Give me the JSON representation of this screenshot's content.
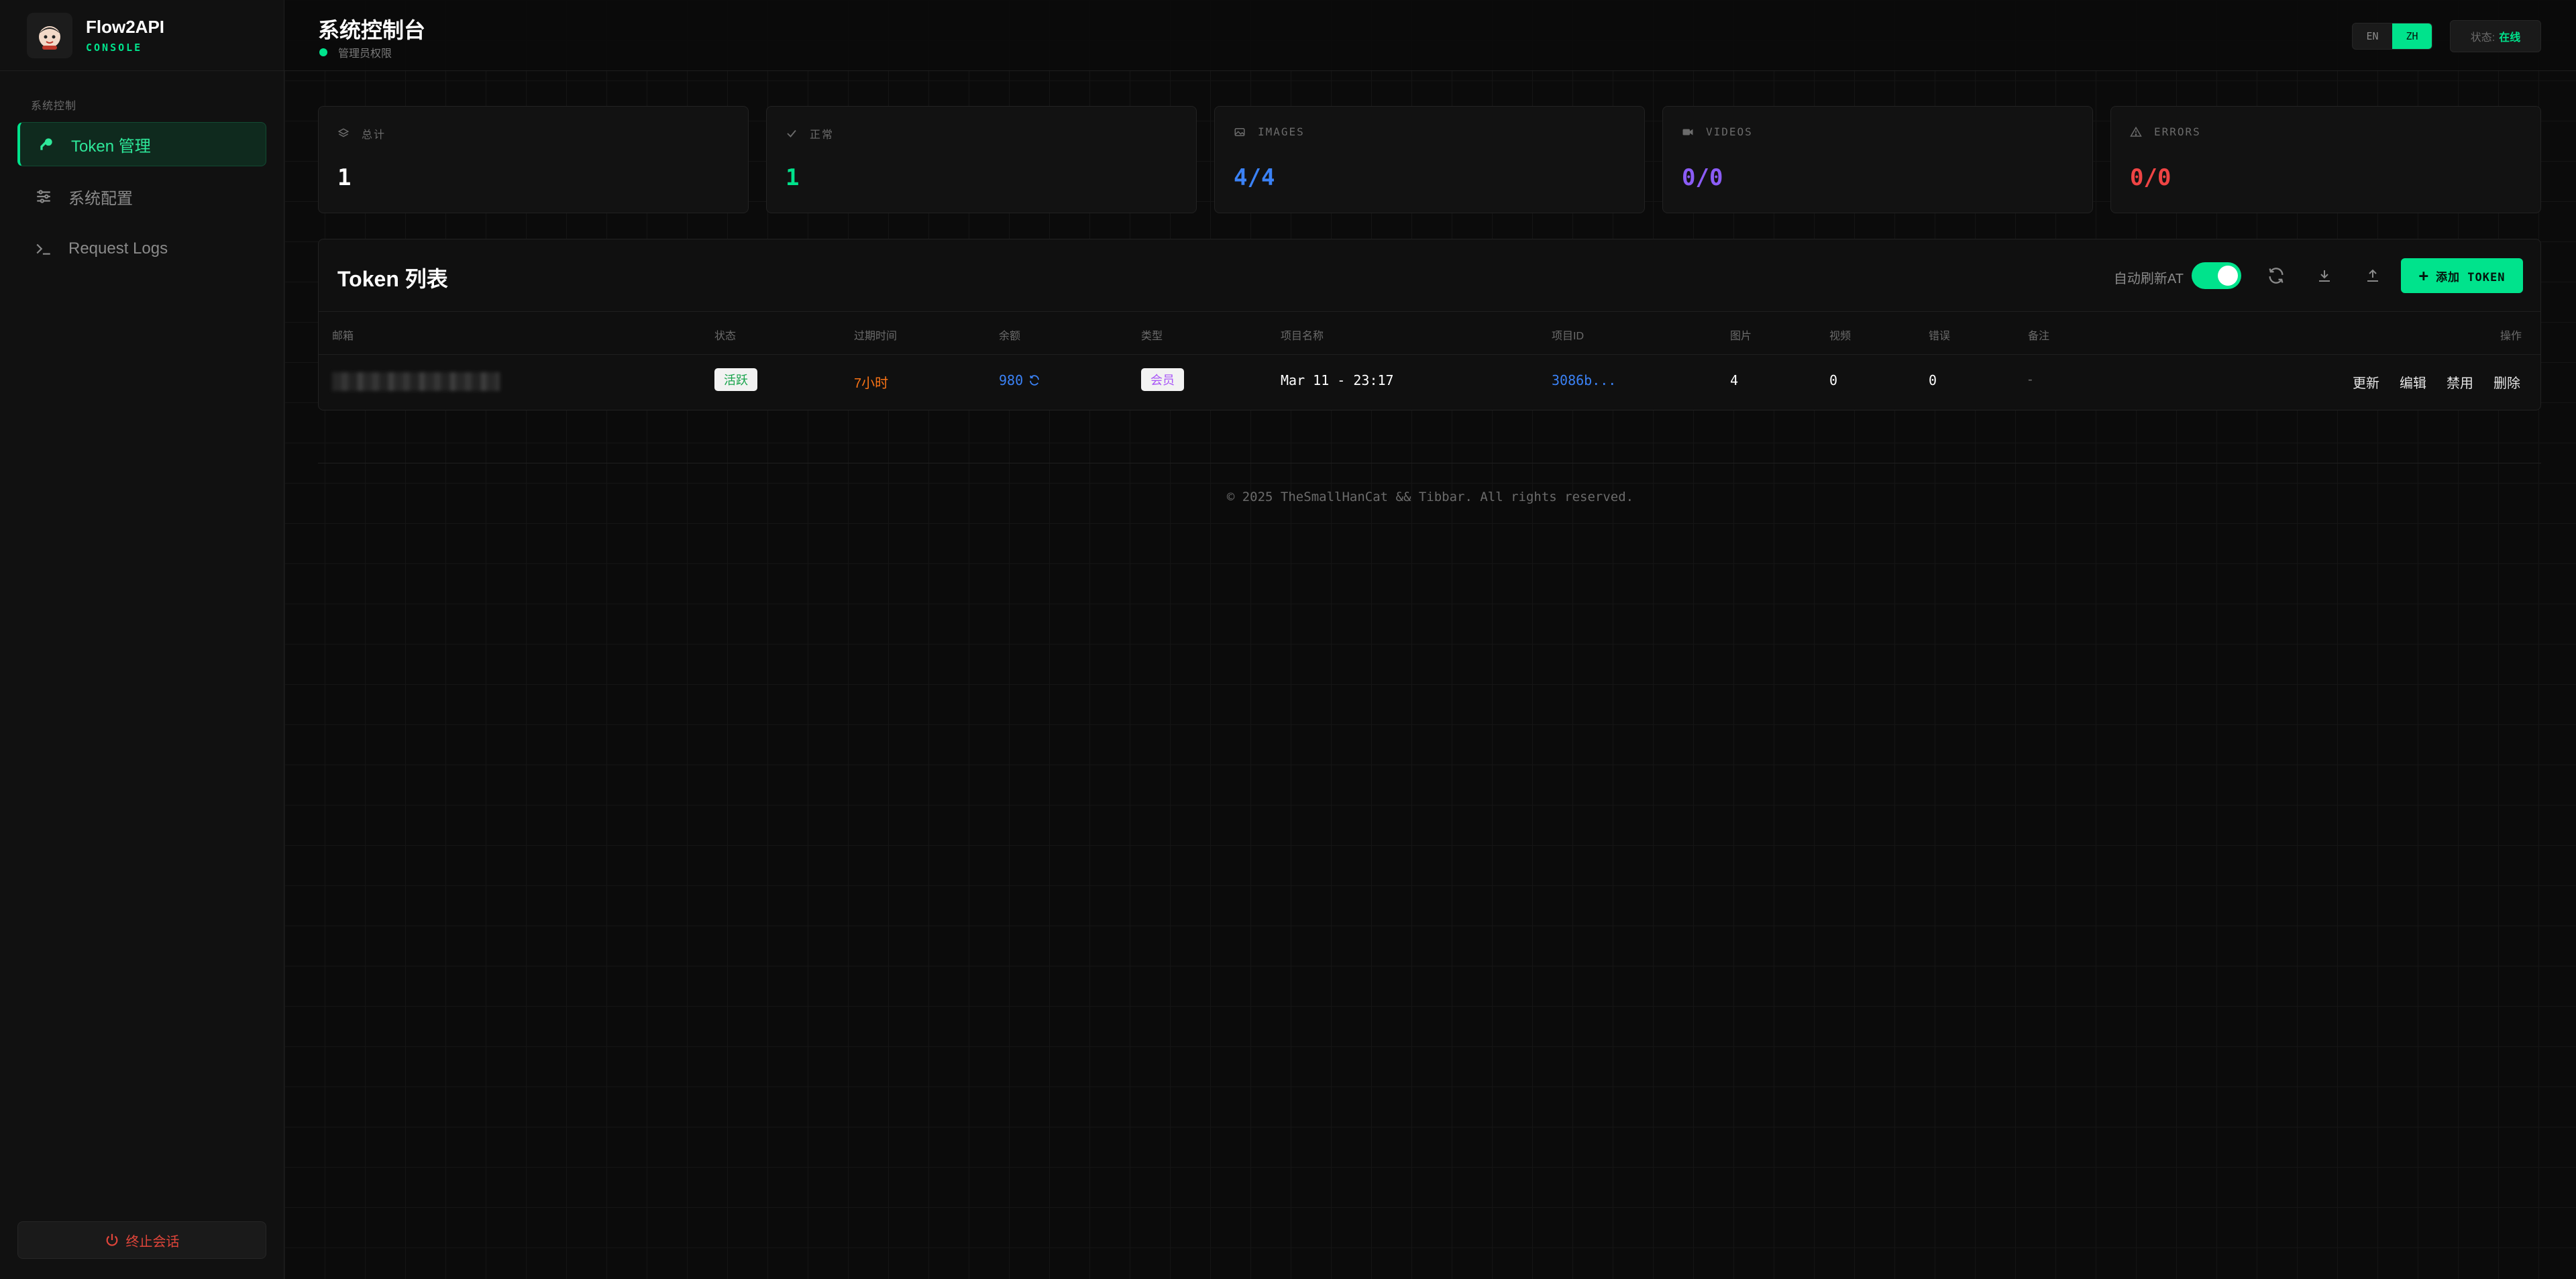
{
  "brand": {
    "title": "Flow2API",
    "subtitle": "CONSOLE"
  },
  "sidebar": {
    "section_label": "系统控制",
    "items": [
      {
        "label": "Token 管理",
        "icon": "key-icon",
        "active": true
      },
      {
        "label": "系统配置",
        "icon": "sliders-icon",
        "active": false
      },
      {
        "label": "Request Logs",
        "icon": "terminal-icon",
        "active": false
      }
    ],
    "logout_label": "终止会话"
  },
  "header": {
    "title": "系统控制台",
    "subtitle": "管理员权限",
    "lang": {
      "en": "EN",
      "zh": "ZH",
      "selected": "ZH"
    },
    "status_label": "状态:",
    "status_value": "在线"
  },
  "stats": [
    {
      "label": "总计",
      "value": "1",
      "color": "#ffffff",
      "icon": "layers-icon"
    },
    {
      "label": "正常",
      "value": "1",
      "color": "#00e38c",
      "icon": "check-icon"
    },
    {
      "label": "IMAGES",
      "value": "4/4",
      "color": "#3b82f6",
      "icon": "image-icon"
    },
    {
      "label": "VIDEOS",
      "value": "0/0",
      "color": "#8b5cf6",
      "icon": "video-icon"
    },
    {
      "label": "ERRORS",
      "value": "0/0",
      "color": "#ef4444",
      "icon": "warning-icon"
    }
  ],
  "table": {
    "title": "Token 列表",
    "auto_refresh_label": "自动刷新AT",
    "auto_refresh_on": true,
    "add_button": "添加 TOKEN",
    "columns": [
      "邮箱",
      "状态",
      "过期时间",
      "余额",
      "类型",
      "项目名称",
      "项目ID",
      "图片",
      "视频",
      "错误",
      "备注",
      "操作"
    ],
    "rows": [
      {
        "status": "活跃",
        "expires": "7小时",
        "balance": "980",
        "type": "会员",
        "project_name": "Mar 11 - 23:17",
        "project_id": "3086b...",
        "images": "4",
        "videos": "0",
        "errors": "0",
        "note": "-",
        "actions": [
          "更新",
          "编辑",
          "禁用",
          "删除"
        ]
      }
    ]
  },
  "footer": "© 2025 TheSmallHanCat && Tibbar. All rights reserved."
}
